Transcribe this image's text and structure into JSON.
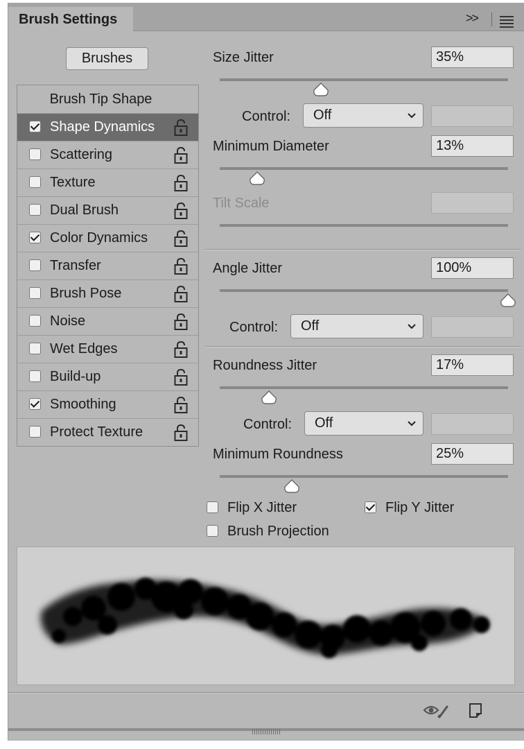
{
  "panel": {
    "tab_title": "Brush Settings",
    "collapse_glyph": ">>"
  },
  "brushes_button": "Brushes",
  "sidebar": {
    "header": "Brush Tip Shape",
    "items": [
      {
        "label": "Shape Dynamics",
        "checked": true,
        "selected": true
      },
      {
        "label": "Scattering",
        "checked": false
      },
      {
        "label": "Texture",
        "checked": false
      },
      {
        "label": "Dual Brush",
        "checked": false
      },
      {
        "label": "Color Dynamics",
        "checked": true
      },
      {
        "label": "Transfer",
        "checked": false
      },
      {
        "label": "Brush Pose",
        "checked": false
      },
      {
        "label": "Noise",
        "checked": false
      },
      {
        "label": "Wet Edges",
        "checked": false
      },
      {
        "label": "Build-up",
        "checked": false
      },
      {
        "label": "Smoothing",
        "checked": true
      },
      {
        "label": "Protect Texture",
        "checked": false
      }
    ]
  },
  "controls": {
    "size_jitter": {
      "label": "Size Jitter",
      "value": "35%",
      "level": 0.35
    },
    "size_control": {
      "label": "Control:",
      "value": "Off"
    },
    "min_diameter": {
      "label": "Minimum Diameter",
      "value": "13%",
      "level": 0.13
    },
    "tilt_scale": {
      "label": "Tilt Scale",
      "value": ""
    },
    "angle_jitter": {
      "label": "Angle Jitter",
      "value": "100%",
      "level": 1.0
    },
    "angle_control": {
      "label": "Control:",
      "value": "Off"
    },
    "roundness_jitter": {
      "label": "Roundness Jitter",
      "value": "17%",
      "level": 0.17
    },
    "roundness_control": {
      "label": "Control:",
      "value": "Off"
    },
    "min_roundness": {
      "label": "Minimum Roundness",
      "value": "25%",
      "level": 0.25
    }
  },
  "options": {
    "flip_x": {
      "label": "Flip X Jitter",
      "checked": false
    },
    "flip_y": {
      "label": "Flip Y Jitter",
      "checked": true
    },
    "projection": {
      "label": "Brush Projection",
      "checked": false
    }
  },
  "footer": {
    "icons": [
      "eye-brush-icon",
      "new-preset-icon"
    ]
  }
}
